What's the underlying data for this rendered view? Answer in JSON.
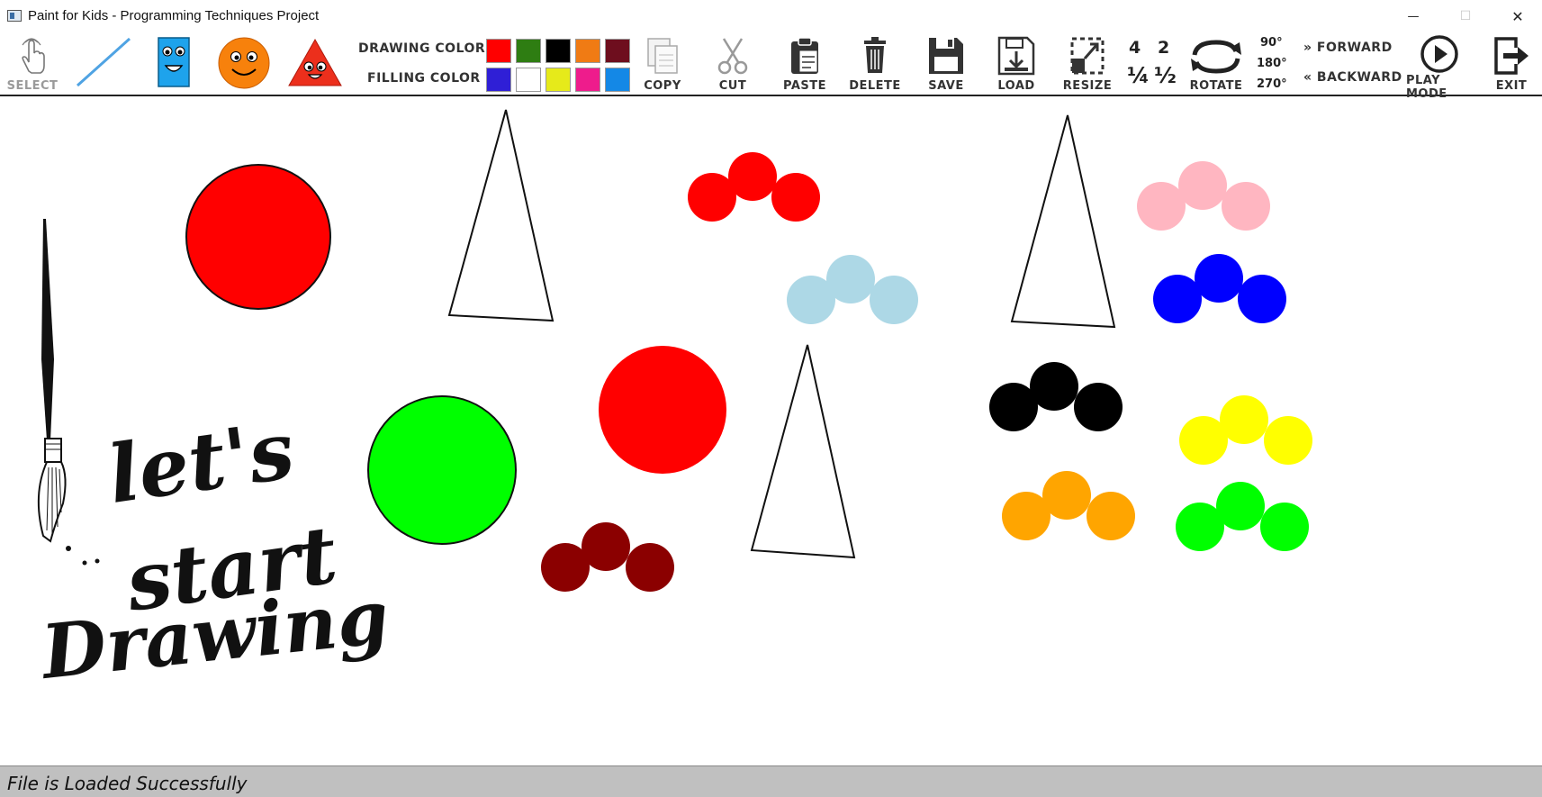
{
  "window": {
    "title": "Paint for Kids - Programming Techniques Project",
    "min_glyph": "—",
    "max_glyph": "☐",
    "close_glyph": "✕"
  },
  "toolbar": {
    "select_label": "SELECT",
    "drawing_color_label": "DRAWING COLOR",
    "filling_color_label": "FILLING COLOR",
    "copy_label": "COPY",
    "cut_label": "CUT",
    "paste_label": "PASTE",
    "delete_label": "DELETE",
    "save_label": "SAVE",
    "load_label": "LOAD",
    "resize_label": "RESIZE",
    "scale_4": "4",
    "scale_2": "2",
    "scale_quarter": "¼",
    "scale_half": "½",
    "rotate_label": "ROTATE",
    "angle_90": "90°",
    "angle_180": "180°",
    "angle_270": "270°",
    "forward_label": "» FORWARD",
    "backward_label": "« BACKWARD",
    "play_mode_label": "PLAY MODE",
    "exit_label": "EXIT"
  },
  "drawing_colors": [
    "#ff0000",
    "#2e7d12",
    "#000000",
    "#f07b14",
    "#6e0e1e"
  ],
  "filling_colors": [
    "#2f1fd6",
    "#ffffff",
    "#e6ea1a",
    "#ee1c8c",
    "#1488e6"
  ],
  "icons": {
    "select": "hand-pointer-icon",
    "line": "line-tool-icon",
    "rectangle": "rectangle-character-icon",
    "circle": "circle-smiley-icon",
    "triangle": "triangle-character-icon",
    "copy": "copy-icon",
    "cut": "scissors-icon",
    "paste": "clipboard-icon",
    "delete": "trash-icon",
    "save": "floppy-disk-icon",
    "load": "load-disk-icon",
    "resize": "resize-icon",
    "rotate": "rotate-arrows-icon",
    "play": "play-icon",
    "exit": "exit-icon"
  },
  "canvas": {
    "slogan_line1": "let's",
    "slogan_line2": "start",
    "slogan_line3": "Drawing"
  },
  "status": {
    "message": "File is Loaded Successfully"
  }
}
